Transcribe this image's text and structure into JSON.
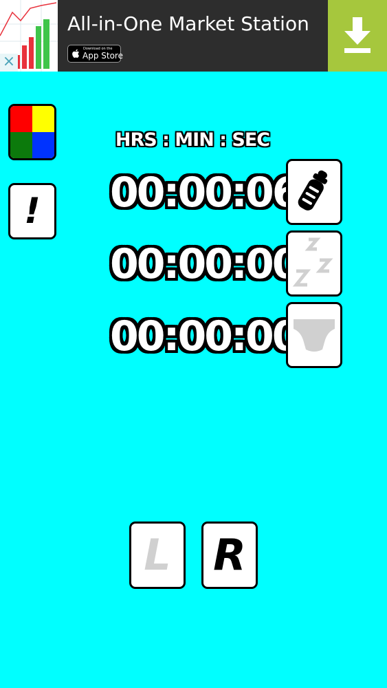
{
  "ad": {
    "title": "All-in-One Market Station",
    "close_glyph": "×",
    "badge_small": "Download on the",
    "badge_big": "App Store",
    "icon": "download-icon",
    "download_color": "#a6c73d"
  },
  "color_picker": {
    "icon": "color-grid-icon",
    "colors": [
      "#ff0000",
      "#ffff00",
      "#0c7a0c",
      "#0033ff"
    ]
  },
  "alert": {
    "label": "!"
  },
  "timers": {
    "header": "HRS : MIN : SEC",
    "feed": {
      "value": "00:00:06",
      "icon": "bottle-icon"
    },
    "sleep": {
      "value": "00:00:00",
      "icon": "sleep-zzz-icon"
    },
    "diaper": {
      "value": "00:00:00",
      "icon": "diaper-icon"
    }
  },
  "sides": {
    "left": "L",
    "right": "R"
  },
  "theme": {
    "background": "#00ffff",
    "tile_border": "#000000",
    "inactive_icon": "#d0d0d0"
  }
}
